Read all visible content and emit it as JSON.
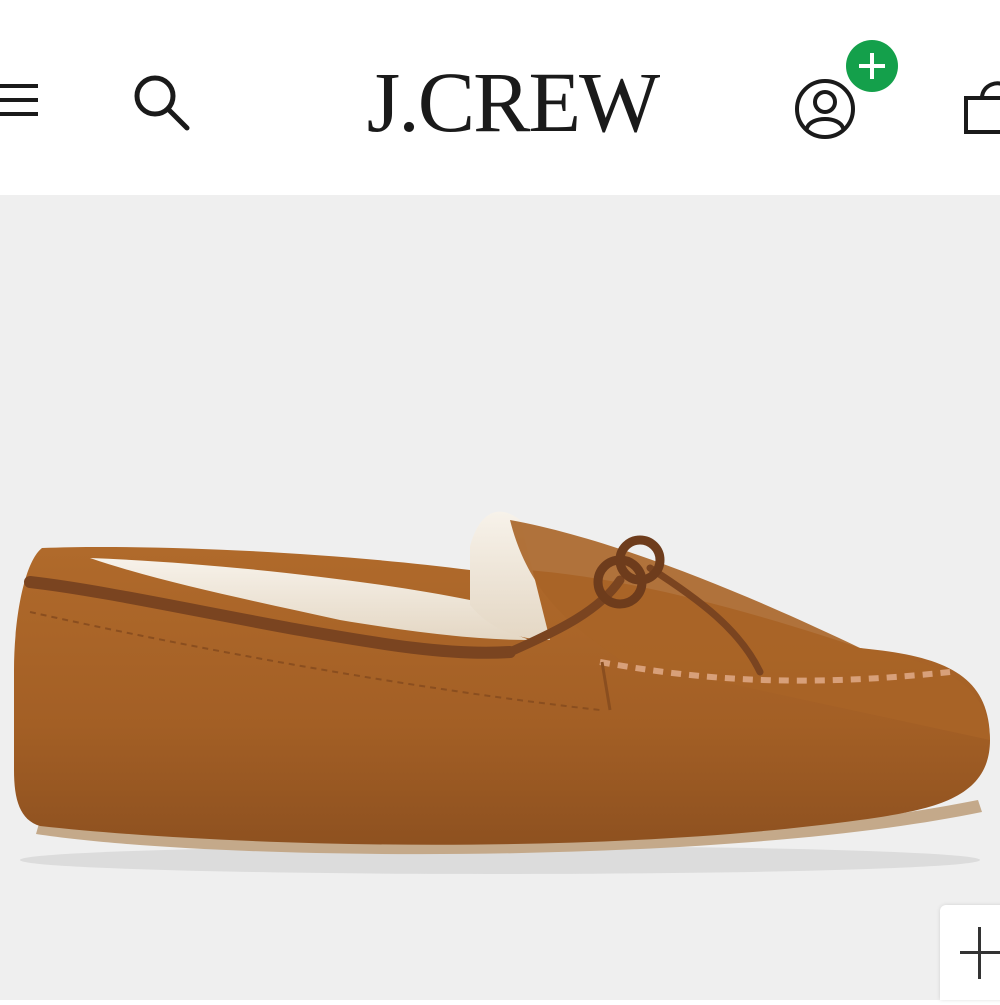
{
  "header": {
    "brand": "J.CREW",
    "menu_icon": "hamburger-menu-icon",
    "search_icon": "search-icon",
    "account_icon": "user-account-icon",
    "account_badge_icon": "plus-icon",
    "bag_icon": "shopping-bag-icon"
  },
  "product": {
    "image_icon": "moccasin-slipper-image",
    "zoom_icon": "plus-icon"
  },
  "colors": {
    "badge": "#14a04b",
    "product_background": "#efefef",
    "suede": "#a35f25",
    "text": "#1a1a1a"
  }
}
